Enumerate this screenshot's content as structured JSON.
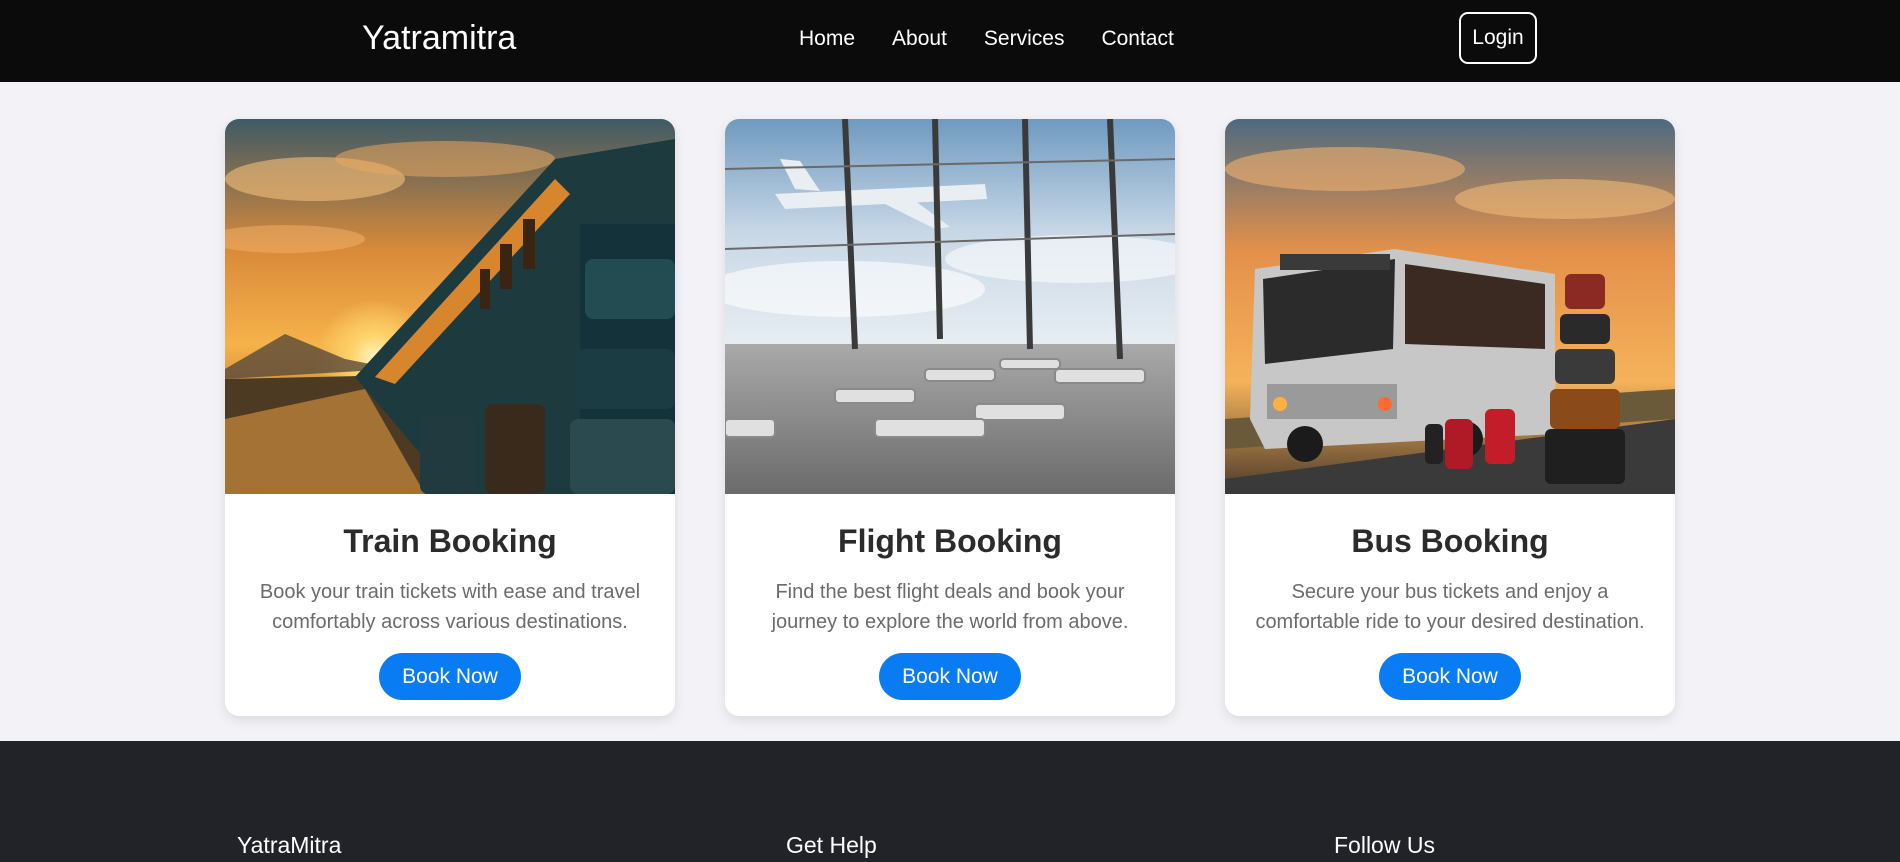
{
  "navbar": {
    "brand": "Yatramitra",
    "links": [
      "Home",
      "About",
      "Services",
      "Contact"
    ],
    "login_label": "Login"
  },
  "cards": [
    {
      "title": "Train Booking",
      "description": "Book your train tickets with ease and travel comfortably across various destinations.",
      "button_label": "Book Now",
      "image": "train-sunset-luggage"
    },
    {
      "title": "Flight Booking",
      "description": "Find the best flight deals and book your journey to explore the world from above.",
      "button_label": "Book Now",
      "image": "airport-lounge-airplane"
    },
    {
      "title": "Bus Booking",
      "description": "Secure your bus tickets and enjoy a comfortable ride to your desired destination.",
      "button_label": "Book Now",
      "image": "bus-sunset-luggage"
    }
  ],
  "footer": {
    "columns": [
      "YatraMitra",
      "Get Help",
      "Follow Us"
    ]
  },
  "colors": {
    "navbar_bg": "#0b0b0b",
    "page_bg": "#f3f3f7",
    "accent": "#0a7cf3",
    "footer_bg": "#222328"
  }
}
